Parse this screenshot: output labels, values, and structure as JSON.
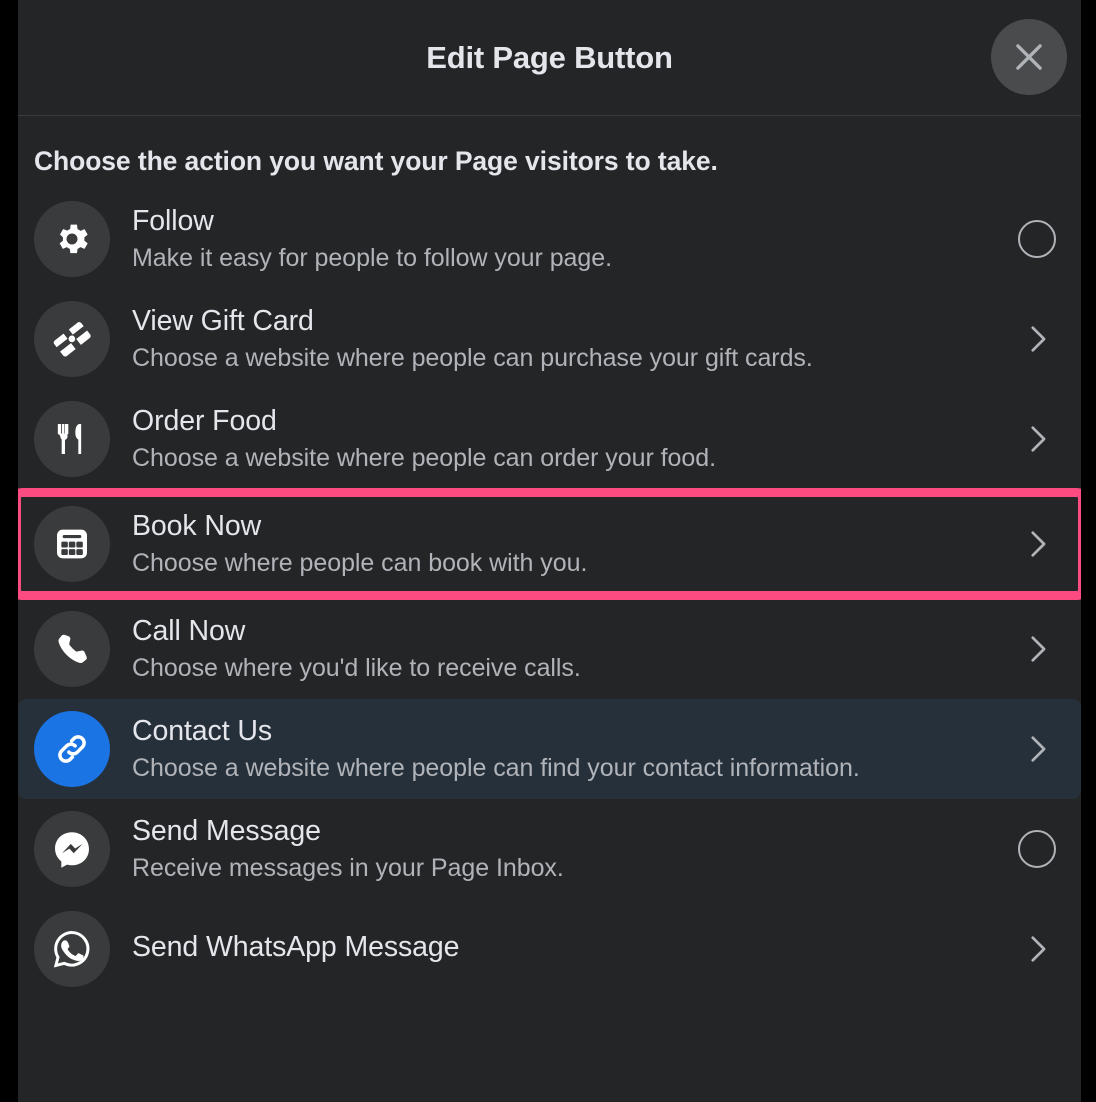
{
  "dialog": {
    "title": "Edit Page Button",
    "close_label": "Close",
    "close_icon": "close-icon"
  },
  "body": {
    "heading": "Choose the action you want your Page visitors to take."
  },
  "colors": {
    "background": "#242526",
    "surround": "#000000",
    "icon_circle": "#3a3b3c",
    "brand_blue": "#1b74e4",
    "hover_row": "#26303b",
    "annotation_pink": "#fb4b81",
    "primary_text": "#e4e6eb",
    "secondary_text": "#b0b3b8"
  },
  "actions": [
    {
      "title": "Follow",
      "description": "Make it easy for people to follow your page.",
      "icon": "gear-icon",
      "affordance": "radio-unselected",
      "state": "default"
    },
    {
      "title": "View Gift Card",
      "description": "Choose a website where people can purchase your gift cards.",
      "icon": "gift-card-icon",
      "affordance": "chevron-right",
      "state": "default"
    },
    {
      "title": "Order Food",
      "description": "Choose a website where people can order your food.",
      "icon": "fork-knife-icon",
      "affordance": "chevron-right",
      "state": "default"
    },
    {
      "title": "Book Now",
      "description": "Choose where people can book with you.",
      "icon": "calendar-icon",
      "affordance": "chevron-right",
      "state": "annotated"
    },
    {
      "title": "Call Now",
      "description": "Choose where you'd like to receive calls.",
      "icon": "phone-icon",
      "affordance": "chevron-right",
      "state": "default"
    },
    {
      "title": "Contact Us",
      "description": "Choose a website where people can find your contact information.",
      "icon": "link-icon",
      "affordance": "chevron-right",
      "state": "hover"
    },
    {
      "title": "Send Message",
      "description": "Receive messages in your Page Inbox.",
      "icon": "messenger-icon",
      "affordance": "radio-unselected",
      "state": "default"
    },
    {
      "title": "Send WhatsApp Message",
      "description": "",
      "icon": "whatsapp-icon",
      "affordance": "chevron-right",
      "state": "default"
    }
  ]
}
